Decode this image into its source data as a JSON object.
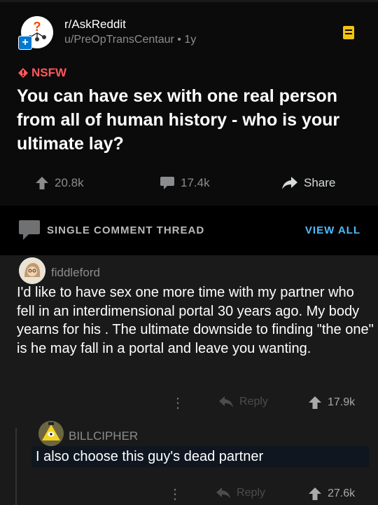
{
  "post": {
    "subreddit": "r/AskReddit",
    "author": "u/PreOpTransCentaur",
    "age": "1y",
    "nsfw_label": "NSFW",
    "title": "You can have sex with one real person from all of human history - who is your ultimate lay?",
    "upvotes": "20.8k",
    "comments": "17.4k",
    "share_label": "Share"
  },
  "thread": {
    "label": "SINGLE COMMENT THREAD",
    "view_all": "VIEW ALL"
  },
  "comment": {
    "author": "fiddleford",
    "body": "I'd like to have sex one more time with my partner who fell in an interdimensional portal 30 years ago. My body yearns for his . The ultimate downside to finding \"the one\" is he may fall in a portal and leave you wanting.",
    "reply_label": "Reply",
    "votes": "17.9k"
  },
  "reply": {
    "author": "BILLCIPHER",
    "body": "I also choose this guy's dead partner",
    "reply_label": "Reply",
    "votes": "27.6k"
  },
  "colors": {
    "nsfw": "#ff585b",
    "link": "#4fbcff",
    "background": "#000000"
  },
  "icons": [
    "askreddit-avatar",
    "join-plus-icon",
    "save-icon",
    "nsfw-diamond-icon",
    "upvote-icon",
    "comment-icon",
    "share-icon",
    "thread-icon",
    "more-icon",
    "reply-icon"
  ]
}
